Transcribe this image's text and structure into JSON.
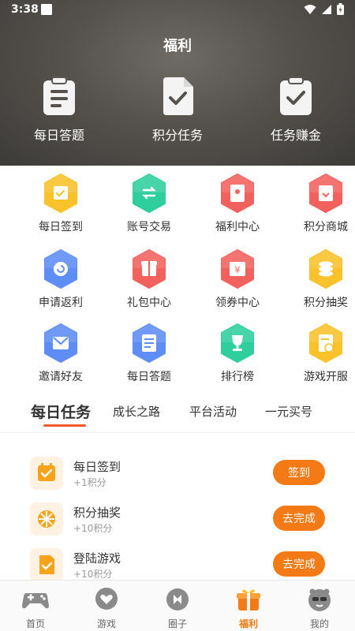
{
  "status_bar": {
    "time": "3:38"
  },
  "header": {
    "title": "福利",
    "features": [
      {
        "label": "每日答题",
        "icon": "clipboard-list-icon"
      },
      {
        "label": "积分任务",
        "icon": "document-check-icon"
      },
      {
        "label": "任务赚金",
        "icon": "clipboard-check-icon"
      }
    ]
  },
  "grid": [
    {
      "label": "每日签到",
      "icon": "calendar-check-icon",
      "color": "#f9c22b"
    },
    {
      "label": "账号交易",
      "icon": "exchange-icon",
      "color": "#2ecf9c"
    },
    {
      "label": "福利中心",
      "icon": "red-envelope-icon",
      "color": "#f2615e"
    },
    {
      "label": "积分商城",
      "icon": "gift-box-icon",
      "color": "#f2615e"
    },
    {
      "label": "申请返利",
      "icon": "refund-icon",
      "color": "#5d8df5"
    },
    {
      "label": "礼包中心",
      "icon": "gift-package-icon",
      "color": "#f2615e"
    },
    {
      "label": "领券中心",
      "icon": "coupon-icon",
      "color": "#f2615e"
    },
    {
      "label": "积分抽奖",
      "icon": "coin-stack-icon",
      "color": "#f9c22b"
    },
    {
      "label": "邀请好友",
      "icon": "invite-mail-icon",
      "color": "#5d8df5"
    },
    {
      "label": "每日答题",
      "icon": "quiz-sheet-icon",
      "color": "#5d8df5"
    },
    {
      "label": "排行榜",
      "icon": "trophy-icon",
      "color": "#2ecf9c"
    },
    {
      "label": "游戏开服",
      "icon": "server-calendar-icon",
      "color": "#f9c22b"
    }
  ],
  "tabs": [
    {
      "label": "每日任务",
      "active": true
    },
    {
      "label": "成长之路",
      "active": false
    },
    {
      "label": "平台活动",
      "active": false
    },
    {
      "label": "一元买号",
      "active": false
    }
  ],
  "tasks": [
    {
      "title": "每日签到",
      "sub": "+1积分",
      "button": "签到",
      "icon": "calendar-check-icon"
    },
    {
      "title": "积分抽奖",
      "sub": "+10积分",
      "button": "去完成",
      "icon": "lottery-wheel-icon"
    },
    {
      "title": "登陆游戏",
      "sub": "+10积分",
      "button": "去完成",
      "icon": "document-check-icon"
    }
  ],
  "bottom_nav": [
    {
      "label": "首页",
      "icon": "gamepad-icon",
      "active": false
    },
    {
      "label": "游戏",
      "icon": "heart-bubble-icon",
      "active": false
    },
    {
      "label": "圈子",
      "icon": "chat-circle-icon",
      "active": false
    },
    {
      "label": "福利",
      "icon": "gift-icon",
      "active": true
    },
    {
      "label": "我的",
      "icon": "avatar-face-icon",
      "active": false
    }
  ],
  "colors": {
    "accent": "#f37a14",
    "tab_underline": "#f05a28"
  }
}
